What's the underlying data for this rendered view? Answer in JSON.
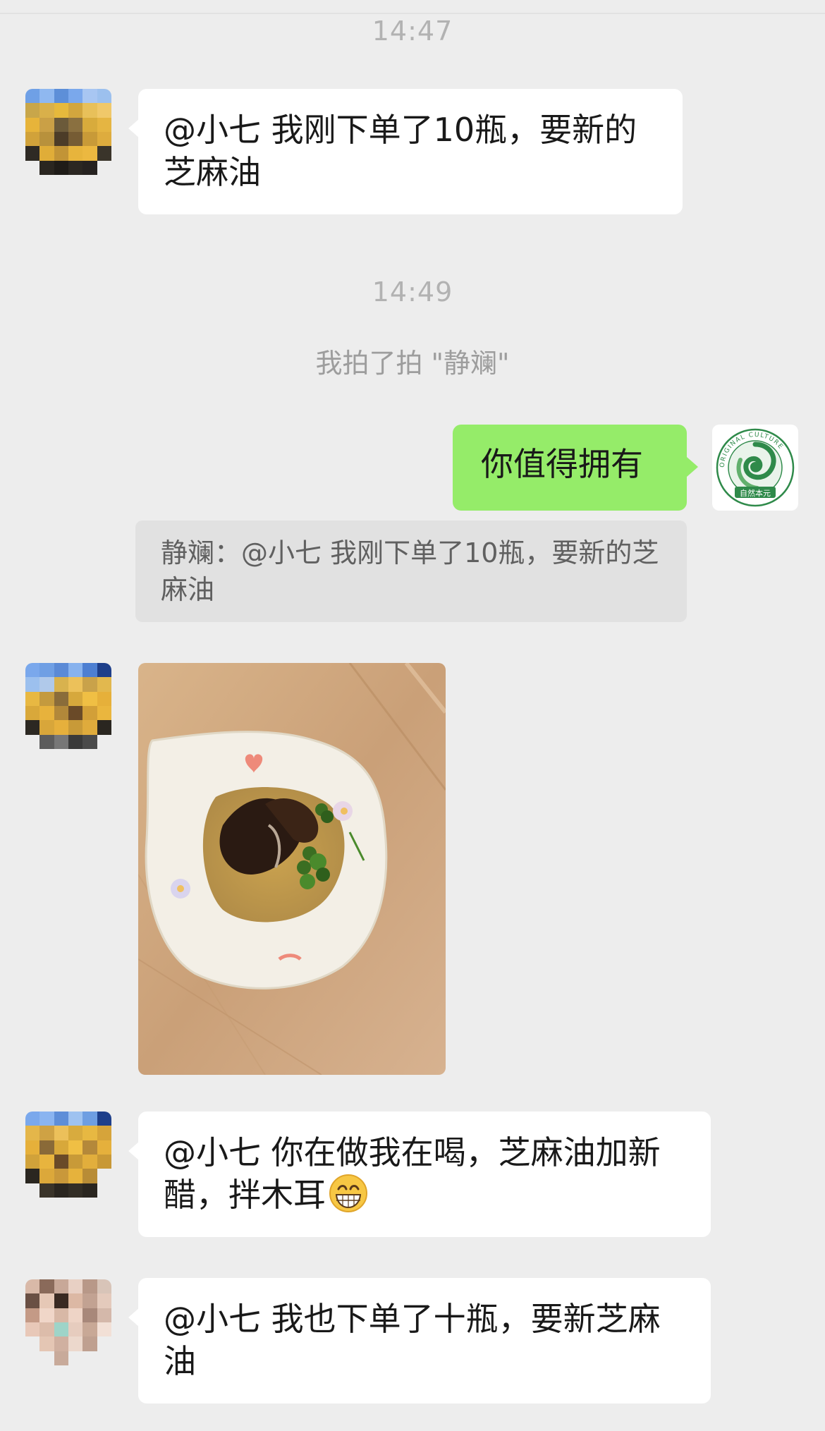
{
  "chat": {
    "time_1": "14:47",
    "msg_1": "@小七 我刚下单了10瓶，要新的芝麻油",
    "time_2": "14:49",
    "pat_notice": "我拍了拍 \"静斓\"",
    "my_reply": "你值得拥有",
    "quote_text": "静斓：@小七 我刚下单了10瓶，要新的芝麻油",
    "msg_3": "@小七 你在做我在喝，芝麻油加新醋，拌木耳",
    "msg_4": "@小七 我也下单了十瓶，要新芝麻油"
  },
  "logo": {
    "ring_text": "ORIGINAL CULTURE",
    "badge_text": "自然本元"
  },
  "icons": {
    "grin_emoji": "grinning-face-emoji",
    "photo": "food-photo-wood-ear-bowl"
  },
  "colors": {
    "background": "#ededed",
    "bubble_incoming": "#ffffff",
    "bubble_outgoing": "#95ec69",
    "quote_bg": "#e1e1e1",
    "time_text": "#b2b2b2"
  }
}
